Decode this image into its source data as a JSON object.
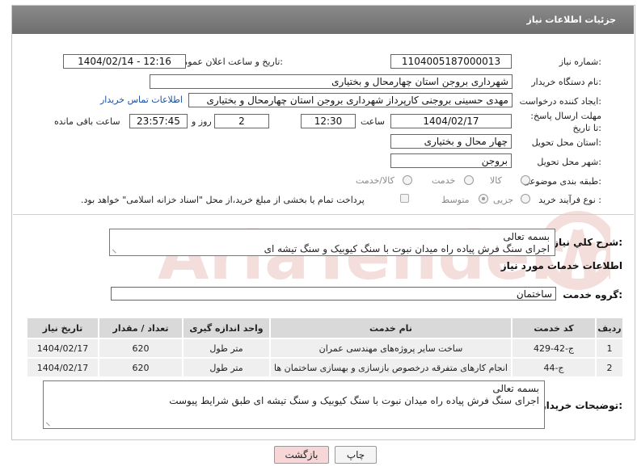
{
  "header": {
    "title": "جزئیات اطلاعات نیاز"
  },
  "fields": {
    "need_number_label": "شماره نیاز:",
    "need_number": "1104005187000013",
    "announce_label": "تاریخ و ساعت اعلان عمومی:",
    "announce_value": "1404/02/14 - 12:16",
    "buyer_org_label": "نام دستگاه خریدار:",
    "buyer_org": "شهرداری بروجن استان چهارمحال و بختیاری",
    "creator_label": "ایجاد کننده درخواست:",
    "creator": "مهدی حسینی بروجنی کارپرداز شهرداری بروجن استان چهارمحال و بختیاری",
    "contact_link": "اطلاعات تماس خریدار",
    "deadline_label": "مهلت ارسال پاسخ: تا تاریخ:",
    "deadline_date": "1404/02/17",
    "time_label": "ساعت",
    "deadline_time": "12:30",
    "days_value": "2",
    "days_label": "روز و",
    "remaining_time": "23:57:45",
    "remaining_label": "ساعت باقی مانده",
    "province_label": "استان محل تحویل:",
    "province": "چهار محال و بختیاری",
    "city_label": "شهر محل تحویل:",
    "city": "بروجن",
    "category_label": "طبقه بندی موضوعی:",
    "category_options": [
      "کالا",
      "خدمت",
      "کالا/خدمت"
    ],
    "process_label": "نوع فرآیند خرید :",
    "process_options": [
      "جزیی",
      "متوسط"
    ],
    "payment_note": "پرداخت تمام یا بخشی از مبلغ خرید،از محل \"اسناد خزانه اسلامی\" خواهد بود."
  },
  "summary": {
    "label": "شرح کلي نياز:",
    "line1": "بسمه تعالی",
    "line2": "اجرای سنگ فرش پیاده راه میدان نبوت با سنگ کیوبیک و سنگ تیشه ای"
  },
  "services": {
    "section_title": "اطلاعات خدمات مورد نیاز",
    "group_label": "گروه خدمت:",
    "group_value": "ساختمان",
    "columns": [
      "ردیف",
      "کد خدمت",
      "نام خدمت",
      "واحد اندازه گیری",
      "تعداد / مقدار",
      "تاریخ نیاز"
    ],
    "rows": [
      [
        "1",
        "ج-42-429",
        "ساخت سایر پروژه‌های مهندسی عمران",
        "متر طول",
        "620",
        "1404/02/17"
      ],
      [
        "2",
        "ج-44",
        "انجام کارهای متفرقه درخصوص بازسازی و بهسازی ساختمان ها",
        "متر طول",
        "620",
        "1404/02/17"
      ]
    ]
  },
  "buyer_notes": {
    "label": "توضیحات خریدار:",
    "line1": "بسمه تعالی",
    "line2": "اجرای سنگ فرش پیاده راه میدان نبوت با سنگ کیوبیک و سنگ تیشه ای طبق شرایط پیوست"
  },
  "buttons": {
    "print": "چاپ",
    "back": "بازگشت"
  },
  "watermark": {
    "text": "AriaTender.neT"
  },
  "colors": {
    "header_bg": "#7a7a7a",
    "link": "#1a4fa0",
    "back_btn_bg": "#f6d6d6",
    "watermark": "#c0392b"
  }
}
